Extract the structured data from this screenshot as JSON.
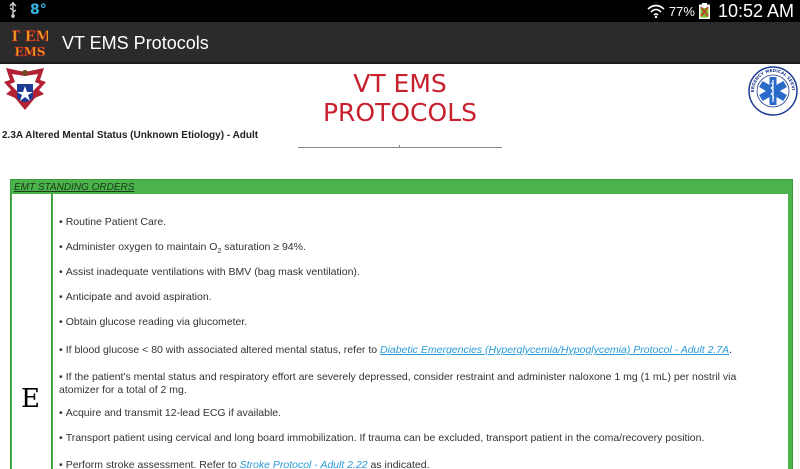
{
  "status_bar": {
    "temperature": "8°",
    "battery_percent": "77%",
    "time": "10:52 AM"
  },
  "app_bar": {
    "logo_text": "VT EMS",
    "title": "VT EMS Protocols"
  },
  "header": {
    "title_line1": "VT EMS",
    "title_line2": "PROTOCOLS",
    "protocol_name": "2.3A Altered Mental Status (Unknown Etiology) - Adult",
    "star_badge_text": "EMERGENCY MEDICAL SERVICES"
  },
  "orders": {
    "section_header": "EMT STANDING ORDERS",
    "level_letter": "E",
    "items": [
      {
        "text": "Routine Patient Care."
      },
      {
        "text_before": "Administer oxygen to maintain O",
        "subscript": "2",
        "text_after": " saturation ≥ 94%."
      },
      {
        "text": "Assist inadequate ventilations with BMV (bag mask ventilation)."
      },
      {
        "text": "Anticipate and avoid aspiration."
      },
      {
        "text": "Obtain glucose reading via glucometer."
      },
      {
        "text_before": "If blood glucose < 80 with associated altered mental status, refer to ",
        "link": "Diabetic Emergencies (Hyperglycemia/Hypoglycemia) Protocol - Adult 2.7A",
        "text_after": "."
      },
      {
        "line1": "If the patient's mental status and respiratory effort are severely depressed, consider restraint and administer naloxone 1 mg (1 mL) per nostril via",
        "line2": "atomizer for a total of 2 mg."
      },
      {
        "text": "Acquire and transmit 12-lead ECG if available."
      },
      {
        "text": "Transport patient using cervical and long board immobilization. If trauma can be excluded, transport patient in the coma/recovery position."
      },
      {
        "text_before": "Perform stroke assessment. Refer to ",
        "link": "Stroke Protocol - Adult 2.22",
        "text_after": " as indicated."
      }
    ]
  },
  "colors": {
    "title_red": "#c8202c",
    "orders_green": "#4cb34c",
    "link_blue": "#2a9ad8",
    "status_blue": "#36b5e5"
  },
  "icons": [
    "usb-icon",
    "wifi-icon",
    "battery-icon",
    "app-logo",
    "eagle-emblem",
    "star-of-life-icon"
  ]
}
